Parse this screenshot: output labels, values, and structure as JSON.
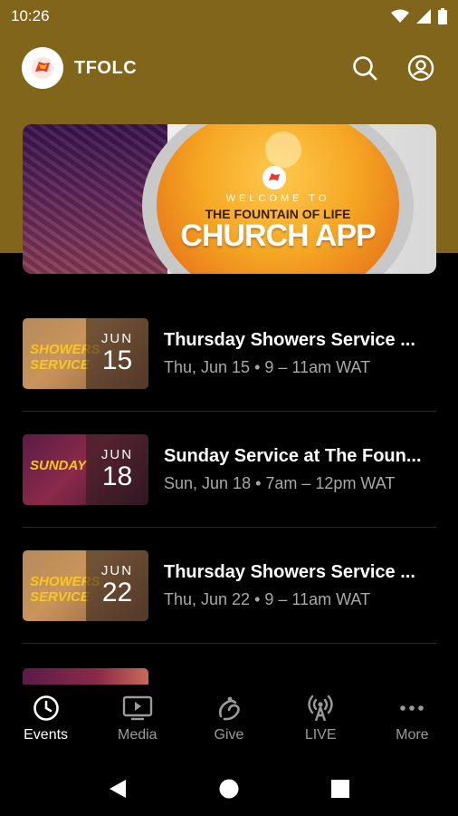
{
  "status_bar": {
    "time": "10:26",
    "icons": [
      "wifi-icon",
      "cellular-signal-icon",
      "battery-icon"
    ]
  },
  "app_bar": {
    "title": "TFOLC",
    "actions": [
      "search-icon",
      "account-icon"
    ]
  },
  "banner": {
    "welcome": "WELCOME TO",
    "church_name": "THE FOUNTAIN OF LIFE",
    "app_label": "CHURCH APP"
  },
  "events": [
    {
      "title": "Thursday Showers Service ...",
      "subtitle": "Thu, Jun 15 • 9 – 11am WAT",
      "month": "JUN",
      "day": "15",
      "thumb_text": "SHOWERS SERVICE",
      "thumb_theme": "orange"
    },
    {
      "title": "Sunday Service at The Foun...",
      "subtitle": "Sun, Jun 18 • 7am – 12pm WAT",
      "month": "JUN",
      "day": "18",
      "thumb_text": "SUNDAY",
      "thumb_theme": "purple"
    },
    {
      "title": "Thursday Showers Service ...",
      "subtitle": "Thu, Jun 22 • 9 – 11am WAT",
      "month": "JUN",
      "day": "22",
      "thumb_text": "SHOWERS SERVICE",
      "thumb_theme": "orange"
    }
  ],
  "bottom_nav": [
    {
      "label": "Events",
      "icon": "clock-icon",
      "active": true
    },
    {
      "label": "Media",
      "icon": "play-screen-icon",
      "active": false
    },
    {
      "label": "Give",
      "icon": "give-hand-icon",
      "active": false
    },
    {
      "label": "LIVE",
      "icon": "broadcast-icon",
      "active": false
    },
    {
      "label": "More",
      "icon": "more-dots-icon",
      "active": false
    }
  ],
  "colors": {
    "header_gold": "#80651a",
    "background": "#000000",
    "text_primary": "#ffffff",
    "text_secondary": "#a8a8a8"
  }
}
